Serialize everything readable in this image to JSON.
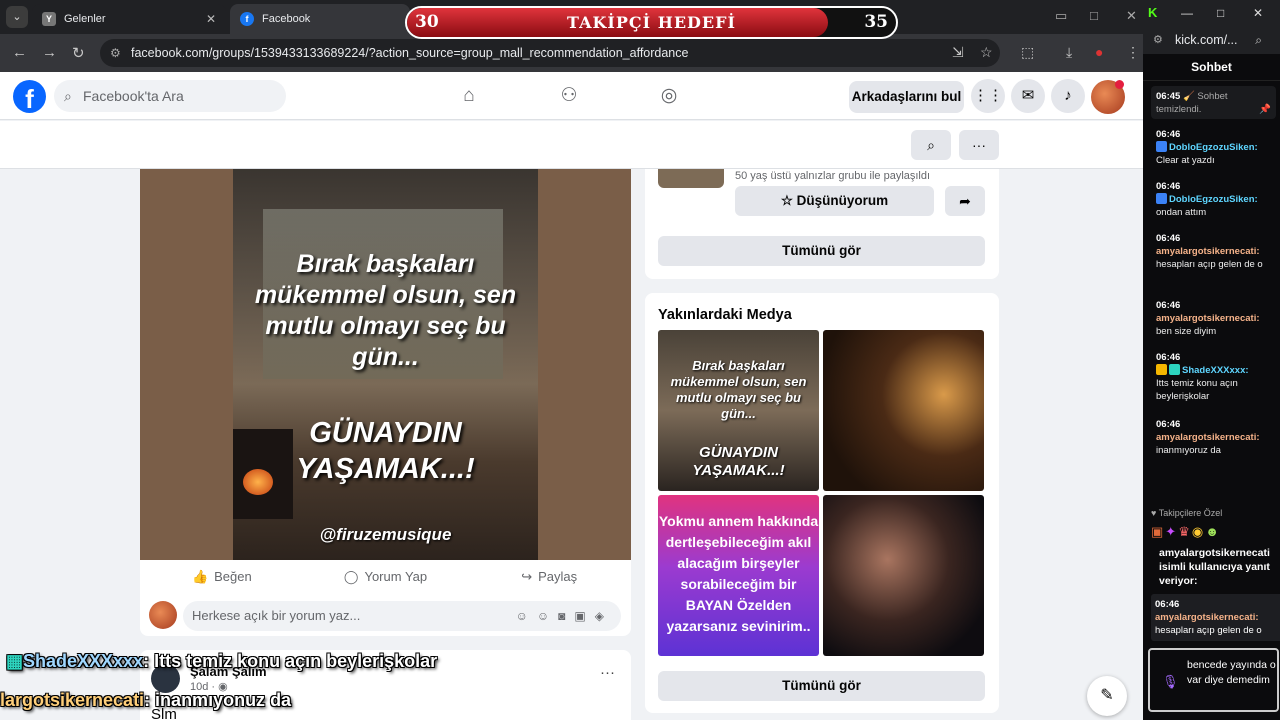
{
  "browser": {
    "tabs": [
      {
        "label": "Gelenler",
        "close": "✕"
      },
      {
        "label": "Facebook"
      }
    ],
    "url": "facebook.com/groups/1539433133689224/?action_source=group_mall_recommendation_affordance"
  },
  "goal": {
    "title": "TAKİPÇİ HEDEFİ",
    "current": "30",
    "target": "35",
    "progress": 0.86,
    "colors": {
      "fill": "#e0343c",
      "track": "#111111"
    }
  },
  "facebook": {
    "search_placeholder": "Facebook'ta Ara",
    "friends_button": "Arkadaşlarını bul",
    "post": {
      "quote": "Bırak başkaları mükemmel olsun, sen mutlu olmayı seç bu gün...",
      "greeting": "GÜNAYDIN YAŞAMAK...!",
      "handle": "@firuzemusique",
      "like": "Beğen",
      "comment": "Yorum Yap",
      "share": "Paylaş",
      "comment_placeholder": "Herkese açık bir yorum yaz..."
    },
    "post2": {
      "name": "Şalam Şalım",
      "meta": "10d · ",
      "text": "Slm"
    },
    "right": {
      "group_subtitle": "50 yaş üstü yalnızlar grubu ile paylaşıldı",
      "interested": "Düşünüyorum",
      "see_all": "Tümünü gör",
      "nearby_title": "Yakınlardaki Medya",
      "media1_quote": "Bırak başkaları mükemmel olsun, sen mutlu olmayı seç bu gün...",
      "media1_greeting": "GÜNAYDIN YAŞAMAK...!",
      "media3_text": "Yokmu annem hakkında dertleşebileceğim akıl alacağım birşeyler sorabileceğim bir BAYAN Özelden yazarsanız sevinirim..",
      "see_all_2": "Tümünü gör"
    }
  },
  "kick": {
    "url": "kick.com/...",
    "header": "Sohbet",
    "system": {
      "time": "06:45",
      "text": "Sohbet temizlendi."
    },
    "messages": [
      {
        "time": "06:46",
        "user": "DobloEgzozuSiken:",
        "text": "Clear at yazdı"
      },
      {
        "time": "06:46",
        "user": "DobloEgzozuSiken:",
        "text": "ondan attım"
      },
      {
        "time": "06:46",
        "user": "amyalargotsikernecati:",
        "text": "hesapları açıp gelen de o"
      },
      {
        "time": "06:46",
        "user": "amyalargotsikernecati:",
        "text": "ben size diyim"
      },
      {
        "time": "06:46",
        "user": "ShadeXXXxxx:",
        "text": "Itts temiz konu açın beylerişkolar"
      },
      {
        "time": "06:46",
        "user": "amyalargotsikernecati:",
        "text": "inanmıyoruz da"
      }
    ],
    "emote_title": "Takipçilere Özel",
    "reply_title": "amyalargotsikernecati isimli kullanıcıya yanıt veriyor:",
    "reply_time": "06:46",
    "reply_user": "amyalargotsikernecati:",
    "reply_text": "hesapları açıp gelen de o",
    "input_text": "bencede yayında o var diye demedim"
  },
  "overlay": {
    "line1_user": "ShadeXXXxxx",
    "line1_text": ": Itts temiz konu açın beylerişkolar",
    "line2_user": "largotsikernecati",
    "line2_text": ": inanmıyonuz da"
  }
}
